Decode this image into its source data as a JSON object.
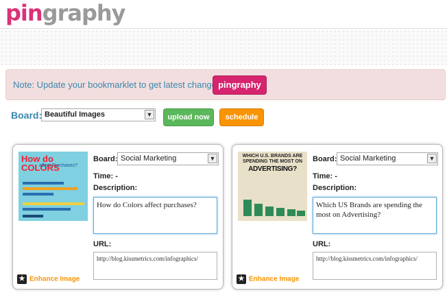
{
  "logo": {
    "part1": "pin",
    "part2": "graphy"
  },
  "note": {
    "text": "Note: Update your bookmarklet to get latest changes",
    "button": "pingraphy"
  },
  "toolbar": {
    "board_label": "Board:",
    "board_value": "Beautiful Images",
    "upload_label": "upload now",
    "schedule_label": "schedule"
  },
  "cards": [
    {
      "board_label": "Board:",
      "board_value": "Social Marketing",
      "time_label": "Time: -",
      "description_label": "Description:",
      "description": "How do Colors affect purchases?",
      "url_label": "URL:",
      "url": "http://blog.kissmetrics.com/infographics/",
      "enhance": "Enhance Image",
      "thumb_title": "How do COLORS",
      "thumb_sub": "affect Purchases?"
    },
    {
      "board_label": "Board:",
      "board_value": "Social Marketing",
      "time_label": "Time: -",
      "description_label": "Description:",
      "description": "Which US Brands are spending the most on Advertising?",
      "url_label": "URL:",
      "url": "http://blog.kissmetrics.com/infographics/",
      "enhance": "Enhance Image",
      "thumb_title": "WHICH U.S. BRANDS ARE SPENDING THE MOST ON",
      "thumb_sub": "ADVERTISING?"
    }
  ],
  "colors": {
    "brand_pink": "#d6246e",
    "note_bg": "#f2dede",
    "upload_green": "#5bb75b",
    "schedule_orange": "#f89406"
  }
}
